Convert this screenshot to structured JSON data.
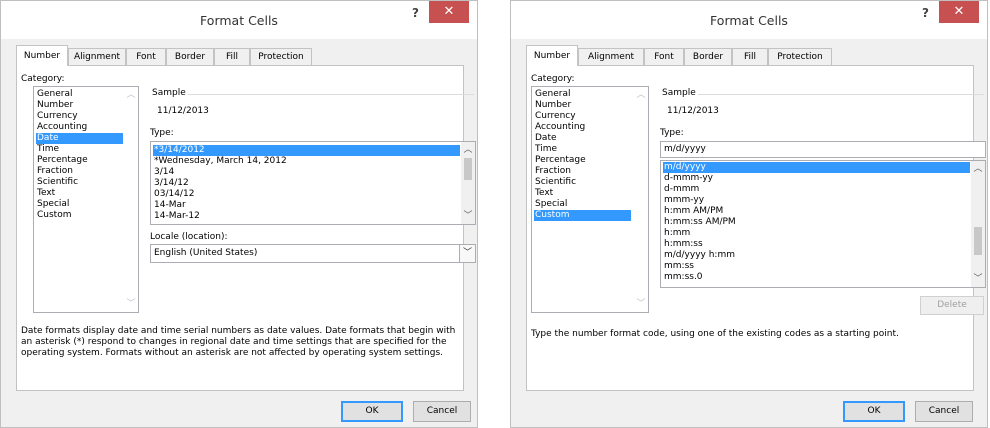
{
  "dialog1": {
    "title": "Format Cells",
    "help": "?",
    "close": "✕",
    "tabs": [
      "Number",
      "Alignment",
      "Font",
      "Border",
      "Fill",
      "Protection"
    ],
    "category_label": "Category:",
    "categories": [
      "General",
      "Number",
      "Currency",
      "Accounting",
      "Date",
      "Time",
      "Percentage",
      "Fraction",
      "Scientific",
      "Text",
      "Special",
      "Custom"
    ],
    "selected_category": "Date",
    "sample_label": "Sample",
    "sample_value": "11/12/2013",
    "type_label": "Type:",
    "types": [
      "*3/14/2012",
      "*Wednesday, March 14, 2012",
      "3/14",
      "3/14/12",
      "03/14/12",
      "14-Mar",
      "14-Mar-12"
    ],
    "locale_label": "Locale (location):",
    "locale_value": "English (United States)",
    "description": "Date formats display date and time serial numbers as date values.  Date formats that begin with an asterisk (*) respond to changes in regional date and time settings that are specified for the operating system. Formats without an asterisk are not affected by operating system settings.",
    "ok": "OK",
    "cancel": "Cancel"
  },
  "dialog2": {
    "title": "Format Cells",
    "help": "?",
    "close": "✕",
    "tabs": [
      "Number",
      "Alignment",
      "Font",
      "Border",
      "Fill",
      "Protection"
    ],
    "category_label": "Category:",
    "categories": [
      "General",
      "Number",
      "Currency",
      "Accounting",
      "Date",
      "Time",
      "Percentage",
      "Fraction",
      "Scientific",
      "Text",
      "Special",
      "Custom"
    ],
    "selected_category": "Custom",
    "sample_label": "Sample",
    "sample_value": "11/12/2013",
    "type_label": "Type:",
    "type_input": "m/d/yyyy",
    "types": [
      "m/d/yyyy",
      "d-mmm-yy",
      "d-mmm",
      "mmm-yy",
      "h:mm AM/PM",
      "h:mm:ss AM/PM",
      "h:mm",
      "h:mm:ss",
      "m/d/yyyy h:mm",
      "mm:ss",
      "mm:ss.0"
    ],
    "delete": "Delete",
    "description": "Type the number format code, using one of the existing codes as a starting point.",
    "ok": "OK",
    "cancel": "Cancel"
  },
  "colors": {
    "selection": "#3399ff",
    "close_button": "#c75050"
  }
}
